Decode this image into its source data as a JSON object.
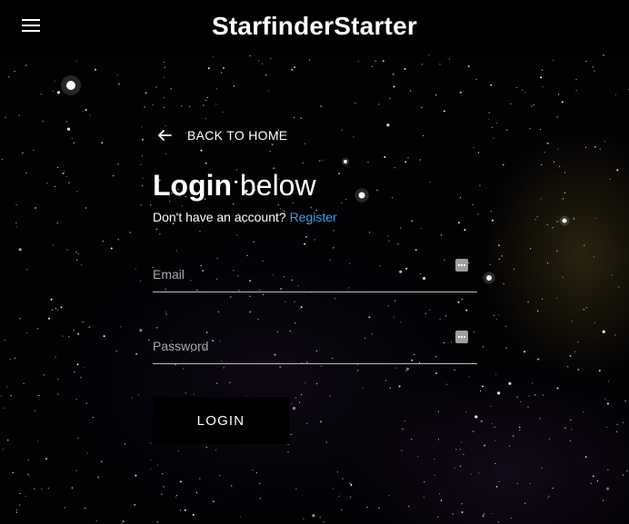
{
  "appbar": {
    "title": "StarfinderStarter",
    "menu_icon": "menu-icon"
  },
  "login": {
    "back_label": "BACK TO HOME",
    "back_icon": "arrow-left-icon",
    "heading_bold": "Login",
    "heading_light": "below",
    "signup_prompt": "Don't have an account?",
    "signup_link": "Register",
    "email_placeholder": "Email",
    "password_placeholder": "Password",
    "submit_label": "LOGIN"
  },
  "colors": {
    "background": "#000000",
    "link": "#3b9bea",
    "text": "#ffffff"
  }
}
